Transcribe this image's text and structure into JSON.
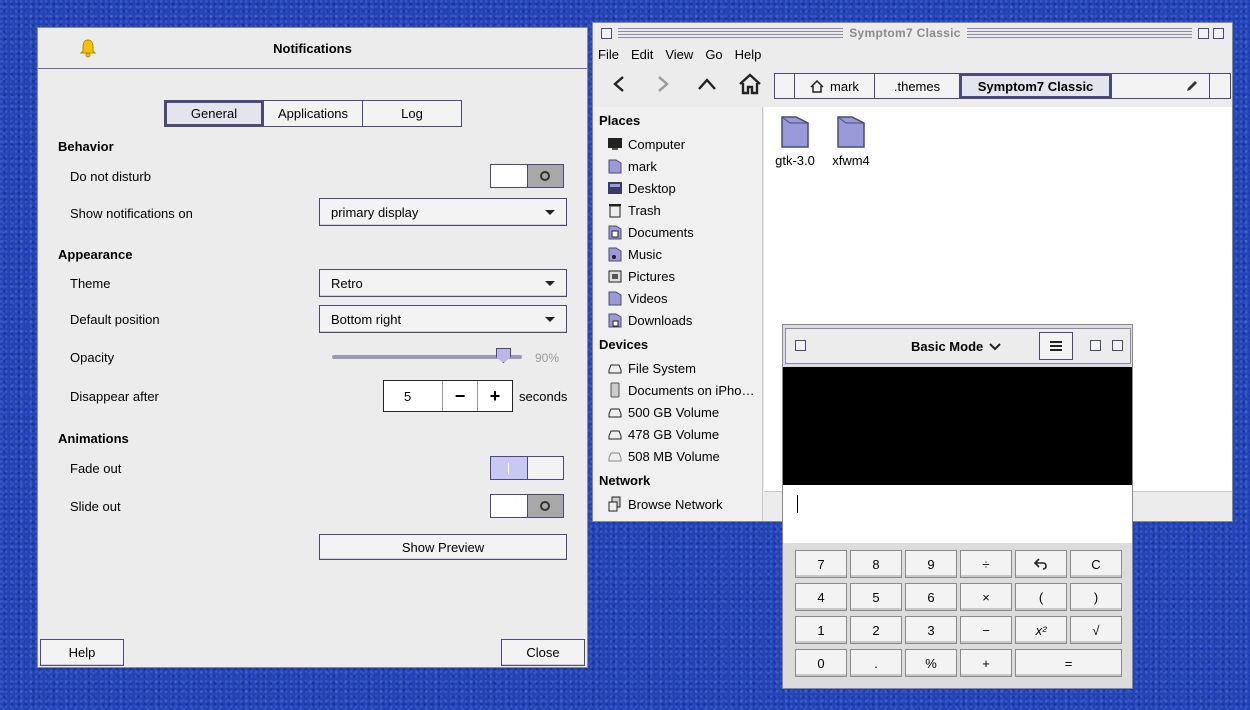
{
  "colors": {
    "desktop": "#2244b8",
    "accent": "#4a4a7a",
    "window_bg": "#ececec"
  },
  "notifications": {
    "title": "Notifications",
    "title_icon": "bell-icon",
    "tabs": [
      "General",
      "Applications",
      "Log"
    ],
    "active_tab": "General",
    "behavior": {
      "heading": "Behavior",
      "dnd_label": "Do not disturb",
      "dnd_state": "off",
      "show_on_label": "Show notifications on",
      "show_on_value": "primary display"
    },
    "appearance": {
      "heading": "Appearance",
      "theme_label": "Theme",
      "theme_value": "Retro",
      "position_label": "Default position",
      "position_value": "Bottom right",
      "opacity_label": "Opacity",
      "opacity_value": "90%",
      "opacity_fraction": 0.9,
      "disappear_label": "Disappear after",
      "disappear_value": "5",
      "disappear_unit": "seconds",
      "minus": "−",
      "plus": "+"
    },
    "animations": {
      "heading": "Animations",
      "fade_label": "Fade out",
      "fade_state": "on",
      "slide_label": "Slide out",
      "slide_state": "off"
    },
    "preview_button": "Show Preview",
    "help_button": "Help",
    "close_button": "Close"
  },
  "file_manager": {
    "title": "Symptom7 Classic",
    "menu": [
      "File",
      "Edit",
      "View",
      "Go",
      "Help"
    ],
    "breadcrumbs": [
      "mark",
      ".themes",
      "Symptom7 Classic"
    ],
    "places_heading": "Places",
    "places": [
      {
        "label": "Computer",
        "icon": "computer-icon"
      },
      {
        "label": "mark",
        "icon": "home-folder-icon"
      },
      {
        "label": "Desktop",
        "icon": "desktop-icon"
      },
      {
        "label": "Trash",
        "icon": "trash-icon"
      },
      {
        "label": "Documents",
        "icon": "documents-icon"
      },
      {
        "label": "Music",
        "icon": "music-icon"
      },
      {
        "label": "Pictures",
        "icon": "pictures-icon"
      },
      {
        "label": "Videos",
        "icon": "videos-icon"
      },
      {
        "label": "Downloads",
        "icon": "downloads-icon"
      }
    ],
    "devices_heading": "Devices",
    "devices": [
      {
        "label": "File System",
        "icon": "drive-icon"
      },
      {
        "label": "Documents on iPho…",
        "icon": "phone-icon"
      },
      {
        "label": "500 GB Volume",
        "icon": "drive-icon"
      },
      {
        "label": "478 GB Volume",
        "icon": "drive-icon"
      },
      {
        "label": "508 MB Volume",
        "icon": "drive-icon"
      }
    ],
    "network_heading": "Network",
    "network": [
      {
        "label": "Browse Network",
        "icon": "network-icon"
      }
    ],
    "files": [
      {
        "label": "gtk-3.0",
        "icon": "folder-icon"
      },
      {
        "label": "xfwm4",
        "icon": "folder-icon"
      }
    ]
  },
  "calculator": {
    "mode": "Basic Mode",
    "keys": [
      [
        "7",
        "8",
        "9",
        "÷",
        "↶",
        "C"
      ],
      [
        "4",
        "5",
        "6",
        "×",
        "(",
        ")"
      ],
      [
        "1",
        "2",
        "3",
        "−",
        "x²",
        "√"
      ],
      [
        "0",
        ".",
        "%",
        "+",
        "="
      ]
    ]
  }
}
